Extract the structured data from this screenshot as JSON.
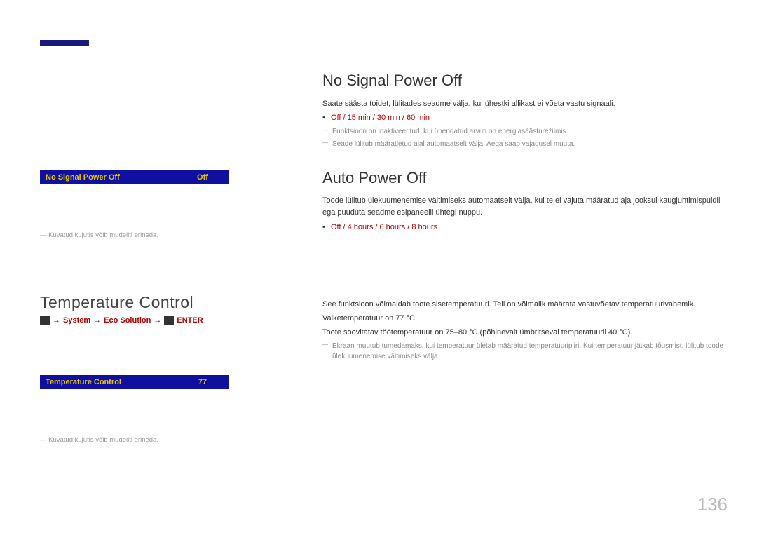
{
  "page_number": "136",
  "left": {
    "ui1": {
      "label": "No Signal Power Off",
      "value": "Off"
    },
    "foot1": "― Kuvatud kujutis võib mudeliti erineda.",
    "heading": "Temperature Control",
    "path": {
      "seg_system": "System",
      "seg_eco": "Eco Solution",
      "seg_enter": "ENTER"
    },
    "ui2": {
      "label": "Temperature Control",
      "value": "77"
    },
    "foot2": "― Kuvatud kujutis võib mudeliti erineda."
  },
  "right": {
    "nosignal": {
      "heading": "No Signal Power Off",
      "p1": "Saate säästa toidet, lülitades seadme välja, kui ühestki allikast ei võeta vastu signaali.",
      "options": "Off / 15 min / 30 min / 60 min",
      "note1": "Funktsioon on inaktiveeritud, kui ühendatud arvuti on energiasäästurežiimis.",
      "note2": "Seade lülitub määratletud ajal automaatselt välja. Aega saab vajadusel muuta."
    },
    "auto": {
      "heading": "Auto Power Off",
      "p1": "Toode lülitub ülekuumenemise vältimiseks automaatselt välja, kui te ei vajuta määratud aja jooksul kaugjuhtimispuldil ega puuduta seadme esipaneelil ühtegi nuppu.",
      "options": "Off / 4 hours / 6 hours / 8 hours"
    },
    "temp": {
      "heading": "Temperature Control",
      "p1": "See funktsioon võimaldab toote sisetemperatuuri. Teil on võimalik määrata vastuvõetav temperatuurivahemik.",
      "p2": "Vaiketemperatuur on 77 °C.",
      "p3": "Toote soovitatav töötemperatuur on 75–80 °C (põhinevalt ümbritseval temperatuuril 40 °C).",
      "note": "Ekraan muutub tumedamaks, kui temperatuur ületab määratud temperatuuripiiri. Kui temperatuur jätkab tõusmist, lülitub toode ülekuumenemise vältimiseks välja."
    }
  }
}
